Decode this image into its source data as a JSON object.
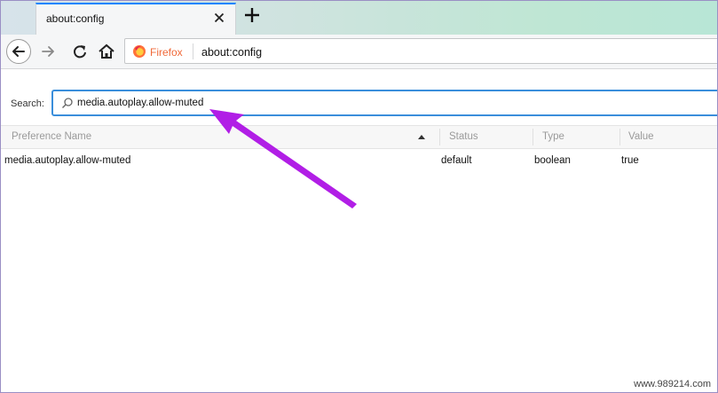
{
  "tab": {
    "title": "about:config"
  },
  "toolbar": {
    "identity_label": "Firefox",
    "url": "about:config"
  },
  "search": {
    "label": "Search:",
    "value": "media.autoplay.allow-muted"
  },
  "table": {
    "columns": [
      "Preference Name",
      "Status",
      "Type",
      "Value"
    ],
    "rows": [
      {
        "name": "media.autoplay.allow-muted",
        "status": "default",
        "type": "boolean",
        "value": "true"
      }
    ]
  },
  "watermark": "www.989214.com",
  "colors": {
    "accent": "#0a84ff",
    "search_border": "#3a8edb",
    "annotation_arrow": "#b11ee6"
  },
  "icons": [
    "close-icon",
    "plus-icon",
    "back-arrow-icon",
    "forward-arrow-icon",
    "reload-icon",
    "home-icon",
    "firefox-logo-icon",
    "search-icon",
    "sort-ascending-icon"
  ]
}
